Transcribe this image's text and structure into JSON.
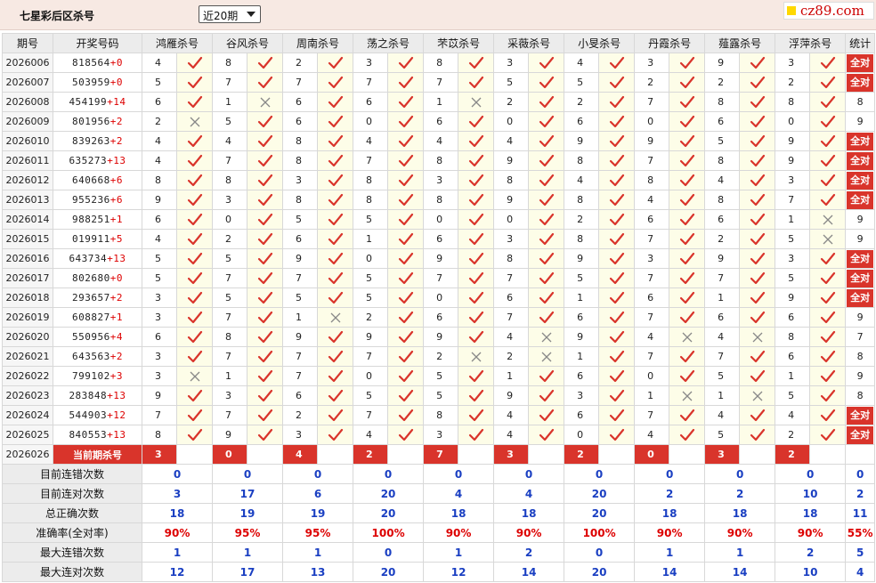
{
  "header": {
    "title": "七星彩后区杀号",
    "select_value": "近20期",
    "logo_text": "cz89.com"
  },
  "columns": [
    "期号",
    "开奖号码",
    "鸿雁杀号",
    "谷风杀号",
    "周南杀号",
    "荡之杀号",
    "芣苡杀号",
    "采薇杀号",
    "小旻杀号",
    "丹霞杀号",
    "薤露杀号",
    "浮萍杀号",
    "统计"
  ],
  "all_right_label": "全对",
  "colors": {
    "accent_red": "#d9342b",
    "check": "#d9342b",
    "cross": "#888888",
    "stat_blue": "#1a3fc2",
    "header_bg": "#ececec",
    "topbar_bg": "#f7e9e3"
  },
  "rows": [
    {
      "issue": "2026006",
      "digits": "818564",
      "sum": "+0",
      "kills": [
        4,
        8,
        2,
        3,
        8,
        3,
        4,
        3,
        9,
        3
      ],
      "ok": [
        1,
        1,
        1,
        1,
        1,
        1,
        1,
        1,
        1,
        1
      ],
      "stat": "全对"
    },
    {
      "issue": "2026007",
      "digits": "503959",
      "sum": "+0",
      "kills": [
        5,
        7,
        7,
        7,
        7,
        5,
        5,
        2,
        2,
        2
      ],
      "ok": [
        1,
        1,
        1,
        1,
        1,
        1,
        1,
        1,
        1,
        1
      ],
      "stat": "全对"
    },
    {
      "issue": "2026008",
      "digits": "454199",
      "sum": "+14",
      "kills": [
        6,
        1,
        6,
        6,
        1,
        2,
        2,
        7,
        8,
        8
      ],
      "ok": [
        1,
        0,
        1,
        1,
        0,
        1,
        1,
        1,
        1,
        1
      ],
      "stat": "8"
    },
    {
      "issue": "2026009",
      "digits": "801956",
      "sum": "+2",
      "kills": [
        2,
        5,
        6,
        0,
        6,
        0,
        6,
        0,
        6,
        0
      ],
      "ok": [
        0,
        1,
        1,
        1,
        1,
        1,
        1,
        1,
        1,
        1
      ],
      "stat": "9"
    },
    {
      "issue": "2026010",
      "digits": "839263",
      "sum": "+2",
      "kills": [
        4,
        4,
        8,
        4,
        4,
        4,
        9,
        9,
        5,
        9
      ],
      "ok": [
        1,
        1,
        1,
        1,
        1,
        1,
        1,
        1,
        1,
        1
      ],
      "stat": "全对"
    },
    {
      "issue": "2026011",
      "digits": "635273",
      "sum": "+13",
      "kills": [
        4,
        7,
        8,
        7,
        8,
        9,
        8,
        7,
        8,
        9
      ],
      "ok": [
        1,
        1,
        1,
        1,
        1,
        1,
        1,
        1,
        1,
        1
      ],
      "stat": "全对"
    },
    {
      "issue": "2026012",
      "digits": "640668",
      "sum": "+6",
      "kills": [
        8,
        8,
        3,
        8,
        3,
        8,
        4,
        8,
        4,
        3
      ],
      "ok": [
        1,
        1,
        1,
        1,
        1,
        1,
        1,
        1,
        1,
        1
      ],
      "stat": "全对"
    },
    {
      "issue": "2026013",
      "digits": "955236",
      "sum": "+6",
      "kills": [
        9,
        3,
        8,
        8,
        8,
        9,
        8,
        4,
        8,
        7
      ],
      "ok": [
        1,
        1,
        1,
        1,
        1,
        1,
        1,
        1,
        1,
        1
      ],
      "stat": "全对"
    },
    {
      "issue": "2026014",
      "digits": "988251",
      "sum": "+1",
      "kills": [
        6,
        0,
        5,
        5,
        0,
        0,
        2,
        6,
        6,
        1
      ],
      "ok": [
        1,
        1,
        1,
        1,
        1,
        1,
        1,
        1,
        1,
        0
      ],
      "stat": "9"
    },
    {
      "issue": "2026015",
      "digits": "019911",
      "sum": "+5",
      "kills": [
        4,
        2,
        6,
        1,
        6,
        3,
        8,
        7,
        2,
        5
      ],
      "ok": [
        1,
        1,
        1,
        1,
        1,
        1,
        1,
        1,
        1,
        0
      ],
      "stat": "9"
    },
    {
      "issue": "2026016",
      "digits": "643734",
      "sum": "+13",
      "kills": [
        5,
        5,
        9,
        0,
        9,
        8,
        9,
        3,
        9,
        3
      ],
      "ok": [
        1,
        1,
        1,
        1,
        1,
        1,
        1,
        1,
        1,
        1
      ],
      "stat": "全对"
    },
    {
      "issue": "2026017",
      "digits": "802680",
      "sum": "+0",
      "kills": [
        5,
        7,
        7,
        5,
        7,
        7,
        5,
        7,
        7,
        5
      ],
      "ok": [
        1,
        1,
        1,
        1,
        1,
        1,
        1,
        1,
        1,
        1
      ],
      "stat": "全对"
    },
    {
      "issue": "2026018",
      "digits": "293657",
      "sum": "+2",
      "kills": [
        3,
        5,
        5,
        5,
        0,
        6,
        1,
        6,
        1,
        9
      ],
      "ok": [
        1,
        1,
        1,
        1,
        1,
        1,
        1,
        1,
        1,
        1
      ],
      "stat": "全对"
    },
    {
      "issue": "2026019",
      "digits": "608827",
      "sum": "+1",
      "kills": [
        3,
        7,
        1,
        2,
        6,
        7,
        6,
        7,
        6,
        6
      ],
      "ok": [
        1,
        1,
        0,
        1,
        1,
        1,
        1,
        1,
        1,
        1
      ],
      "stat": "9"
    },
    {
      "issue": "2026020",
      "digits": "550956",
      "sum": "+4",
      "kills": [
        6,
        8,
        9,
        9,
        9,
        4,
        9,
        4,
        4,
        8
      ],
      "ok": [
        1,
        1,
        1,
        1,
        1,
        0,
        1,
        0,
        0,
        1
      ],
      "stat": "7"
    },
    {
      "issue": "2026021",
      "digits": "643563",
      "sum": "+2",
      "kills": [
        3,
        7,
        7,
        7,
        2,
        2,
        1,
        7,
        7,
        6
      ],
      "ok": [
        1,
        1,
        1,
        1,
        0,
        0,
        1,
        1,
        1,
        1
      ],
      "stat": "8"
    },
    {
      "issue": "2026022",
      "digits": "799102",
      "sum": "+3",
      "kills": [
        3,
        1,
        7,
        0,
        5,
        1,
        6,
        0,
        5,
        1
      ],
      "ok": [
        0,
        1,
        1,
        1,
        1,
        1,
        1,
        1,
        1,
        1
      ],
      "stat": "9"
    },
    {
      "issue": "2026023",
      "digits": "283848",
      "sum": "+13",
      "kills": [
        9,
        3,
        6,
        5,
        5,
        9,
        3,
        1,
        1,
        5
      ],
      "ok": [
        1,
        1,
        1,
        1,
        1,
        1,
        1,
        0,
        0,
        1
      ],
      "stat": "8"
    },
    {
      "issue": "2026024",
      "digits": "544903",
      "sum": "+12",
      "kills": [
        7,
        7,
        2,
        7,
        8,
        4,
        6,
        7,
        4,
        4
      ],
      "ok": [
        1,
        1,
        1,
        1,
        1,
        1,
        1,
        1,
        1,
        1
      ],
      "stat": "全对"
    },
    {
      "issue": "2026025",
      "digits": "840553",
      "sum": "+13",
      "kills": [
        8,
        9,
        3,
        4,
        3,
        4,
        0,
        4,
        5,
        2
      ],
      "ok": [
        1,
        1,
        1,
        1,
        1,
        1,
        1,
        1,
        1,
        1
      ],
      "stat": "全对"
    }
  ],
  "current": {
    "issue": "2026026",
    "label": "当前期杀号",
    "kills": [
      3,
      0,
      4,
      2,
      7,
      3,
      2,
      0,
      3,
      2
    ]
  },
  "stats": [
    {
      "label": "目前连错次数",
      "values": [
        "0",
        "0",
        "0",
        "0",
        "0",
        "0",
        "0",
        "0",
        "0",
        "0",
        "0"
      ],
      "red": false
    },
    {
      "label": "目前连对次数",
      "values": [
        "3",
        "17",
        "6",
        "20",
        "4",
        "4",
        "20",
        "2",
        "2",
        "10",
        "2"
      ],
      "red": false
    },
    {
      "label": "总正确次数",
      "values": [
        "18",
        "19",
        "19",
        "20",
        "18",
        "18",
        "20",
        "18",
        "18",
        "18",
        "11"
      ],
      "red": false
    },
    {
      "label": "准确率(全对率)",
      "values": [
        "90%",
        "95%",
        "95%",
        "100%",
        "90%",
        "90%",
        "100%",
        "90%",
        "90%",
        "90%",
        "55%"
      ],
      "red": true
    },
    {
      "label": "最大连错次数",
      "values": [
        "1",
        "1",
        "1",
        "0",
        "1",
        "2",
        "0",
        "1",
        "1",
        "2",
        "5"
      ],
      "red": false
    },
    {
      "label": "最大连对次数",
      "values": [
        "12",
        "17",
        "13",
        "20",
        "12",
        "14",
        "20",
        "14",
        "14",
        "10",
        "4"
      ],
      "red": false
    }
  ]
}
